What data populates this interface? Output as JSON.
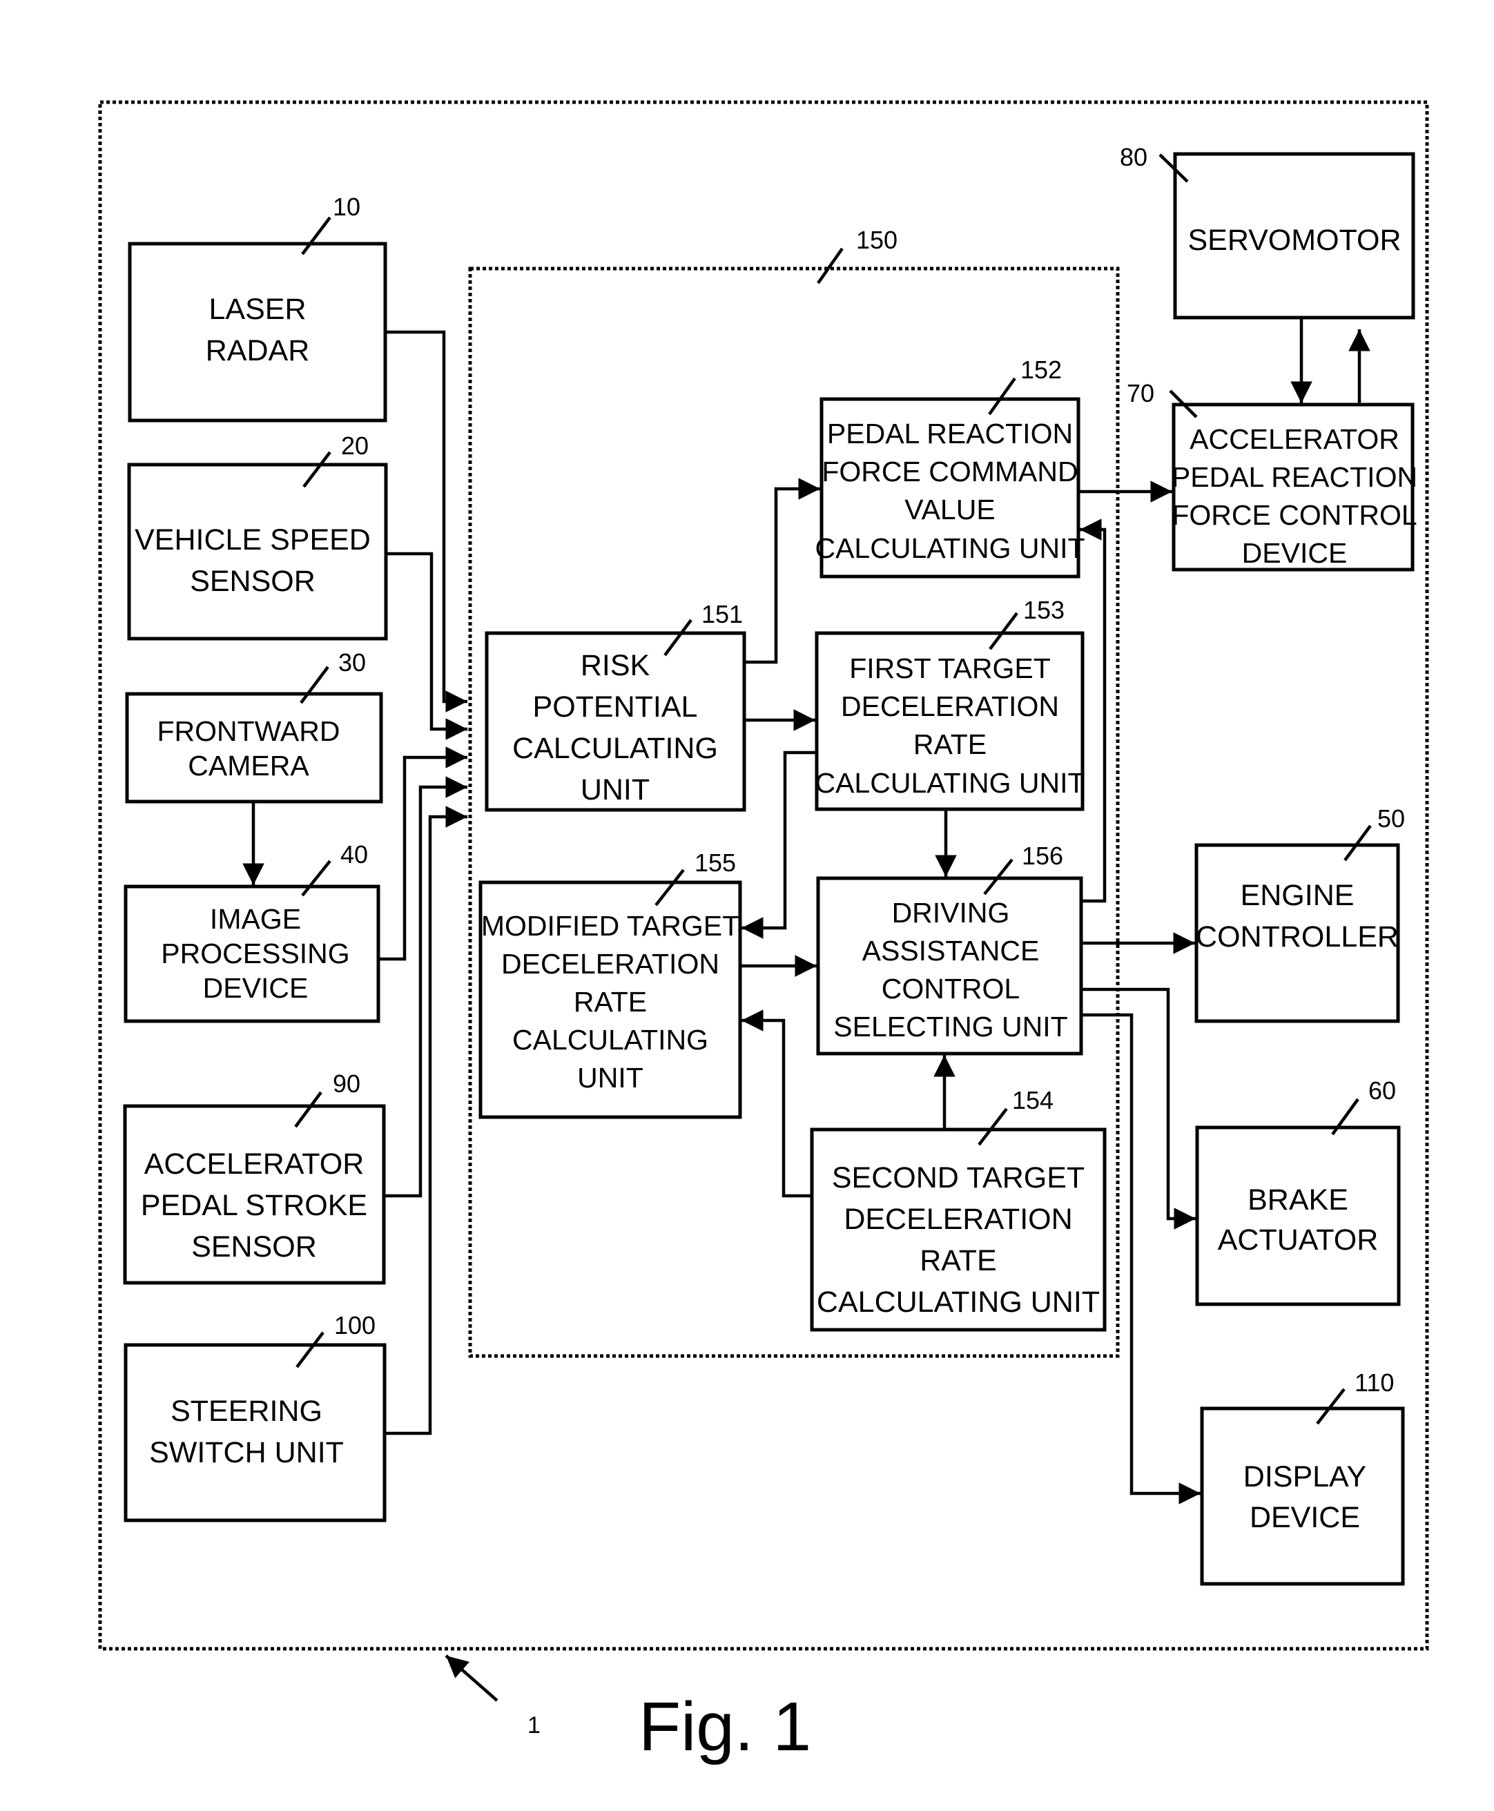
{
  "figure": {
    "caption": "Fig. 1",
    "system_ref": "1"
  },
  "controller": {
    "ref": "150"
  },
  "blocks": {
    "laser_radar": {
      "ref": "10",
      "lines": [
        "LASER",
        "RADAR"
      ]
    },
    "vehicle_speed_sensor": {
      "ref": "20",
      "lines": [
        "VEHICLE SPEED",
        "SENSOR"
      ]
    },
    "frontward_camera": {
      "ref": "30",
      "lines": [
        "FRONTWARD",
        "CAMERA"
      ]
    },
    "image_processing_device": {
      "ref": "40",
      "lines": [
        "IMAGE",
        "PROCESSING",
        "DEVICE"
      ]
    },
    "accelerator_pedal_stroke_sensor": {
      "ref": "90",
      "lines": [
        "ACCELERATOR",
        "PEDAL STROKE",
        "SENSOR"
      ]
    },
    "steering_switch_unit": {
      "ref": "100",
      "lines": [
        "STEERING",
        "SWITCH UNIT"
      ]
    },
    "risk_potential_calculating_unit": {
      "ref": "151",
      "lines": [
        "RISK",
        "POTENTIAL",
        "CALCULATING",
        "UNIT"
      ]
    },
    "pedal_reaction_force_command_value_calculating_unit": {
      "ref": "152",
      "lines": [
        "PEDAL REACTION",
        "FORCE COMMAND",
        "VALUE",
        "CALCULATING UNIT"
      ]
    },
    "first_target_deceleration_rate_calculating_unit": {
      "ref": "153",
      "lines": [
        "FIRST TARGET",
        "DECELERATION",
        "RATE",
        "CALCULATING UNIT"
      ]
    },
    "second_target_deceleration_rate_calculating_unit": {
      "ref": "154",
      "lines": [
        "SECOND TARGET",
        "DECELERATION",
        "RATE",
        "CALCULATING UNIT"
      ]
    },
    "modified_target_deceleration_rate_calculating_unit": {
      "ref": "155",
      "lines": [
        "MODIFIED TARGET",
        "DECELERATION",
        "RATE",
        "CALCULATING",
        "UNIT"
      ]
    },
    "driving_assistance_control_selecting_unit": {
      "ref": "156",
      "lines": [
        "DRIVING",
        "ASSISTANCE",
        "CONTROL",
        "SELECTING UNIT"
      ]
    },
    "servomotor": {
      "ref": "80",
      "lines": [
        "SERVOMOTOR"
      ]
    },
    "accelerator_pedal_reaction_force_control_device": {
      "ref": "70",
      "lines": [
        "ACCELERATOR",
        "PEDAL REACTION",
        "FORCE CONTROL",
        "DEVICE"
      ]
    },
    "engine_controller": {
      "ref": "50",
      "lines": [
        "ENGINE",
        "CONTROLLER"
      ]
    },
    "brake_actuator": {
      "ref": "60",
      "lines": [
        "BRAKE",
        "ACTUATOR"
      ]
    },
    "display_device": {
      "ref": "110",
      "lines": [
        "DISPLAY",
        "DEVICE"
      ]
    }
  },
  "connections": [
    {
      "from": "laser_radar",
      "to": "controller"
    },
    {
      "from": "vehicle_speed_sensor",
      "to": "controller"
    },
    {
      "from": "frontward_camera",
      "to": "image_processing_device"
    },
    {
      "from": "image_processing_device",
      "to": "controller"
    },
    {
      "from": "accelerator_pedal_stroke_sensor",
      "to": "controller"
    },
    {
      "from": "steering_switch_unit",
      "to": "controller"
    },
    {
      "from": "risk_potential_calculating_unit",
      "to": "pedal_reaction_force_command_value_calculating_unit"
    },
    {
      "from": "risk_potential_calculating_unit",
      "to": "first_target_deceleration_rate_calculating_unit"
    },
    {
      "from": "first_target_deceleration_rate_calculating_unit",
      "to": "driving_assistance_control_selecting_unit"
    },
    {
      "from": "first_target_deceleration_rate_calculating_unit",
      "to": "modified_target_deceleration_rate_calculating_unit"
    },
    {
      "from": "second_target_deceleration_rate_calculating_unit",
      "to": "driving_assistance_control_selecting_unit"
    },
    {
      "from": "second_target_deceleration_rate_calculating_unit",
      "to": "modified_target_deceleration_rate_calculating_unit"
    },
    {
      "from": "modified_target_deceleration_rate_calculating_unit",
      "to": "driving_assistance_control_selecting_unit"
    },
    {
      "from": "driving_assistance_control_selecting_unit",
      "to": "pedal_reaction_force_command_value_calculating_unit"
    },
    {
      "from": "driving_assistance_control_selecting_unit",
      "to": "engine_controller"
    },
    {
      "from": "driving_assistance_control_selecting_unit",
      "to": "brake_actuator"
    },
    {
      "from": "driving_assistance_control_selecting_unit",
      "to": "display_device"
    },
    {
      "from": "pedal_reaction_force_command_value_calculating_unit",
      "to": "accelerator_pedal_reaction_force_control_device"
    },
    {
      "from": "servomotor",
      "to": "accelerator_pedal_reaction_force_control_device"
    },
    {
      "from": "accelerator_pedal_reaction_force_control_device",
      "to": "servomotor"
    }
  ]
}
